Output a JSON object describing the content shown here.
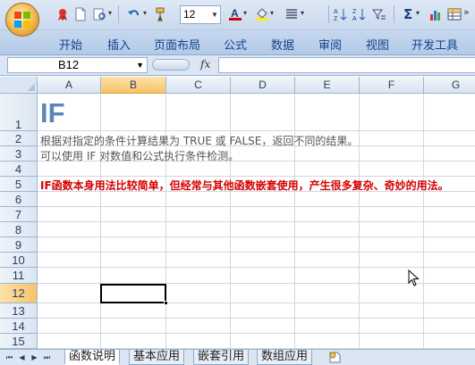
{
  "quick_access": {
    "font_size": "12"
  },
  "ribbon": {
    "tabs": [
      "开始",
      "插入",
      "页面布局",
      "公式",
      "数据",
      "审阅",
      "视图",
      "开发工具"
    ]
  },
  "formula_bar": {
    "name_box": "B12",
    "fx_label": "fx",
    "formula": ""
  },
  "grid": {
    "columns": [
      "A",
      "B",
      "C",
      "D",
      "E",
      "F",
      "G"
    ],
    "selected_column": "B",
    "rows": [
      "1",
      "2",
      "3",
      "4",
      "5",
      "6",
      "7",
      "8",
      "9",
      "10",
      "11",
      "12",
      "13",
      "14",
      "15"
    ],
    "selected_row": "12",
    "cells": {
      "A1": "IF",
      "A2": "根据对指定的条件计算结果为 TRUE 或 FALSE，返回不同的结果。",
      "A3": "可以使用 IF 对数值和公式执行条件检测。",
      "A5": "IF函数本身用法比较简单，但经常与其他函数嵌套使用，产生很多复杂、奇妙的用法。"
    },
    "colors": {
      "title": "#5a86b8",
      "note": "#d40000"
    }
  },
  "sheets": {
    "tabs": [
      "函数说明",
      "基本应用",
      "嵌套引用",
      "数组应用"
    ],
    "active": "函数说明"
  }
}
